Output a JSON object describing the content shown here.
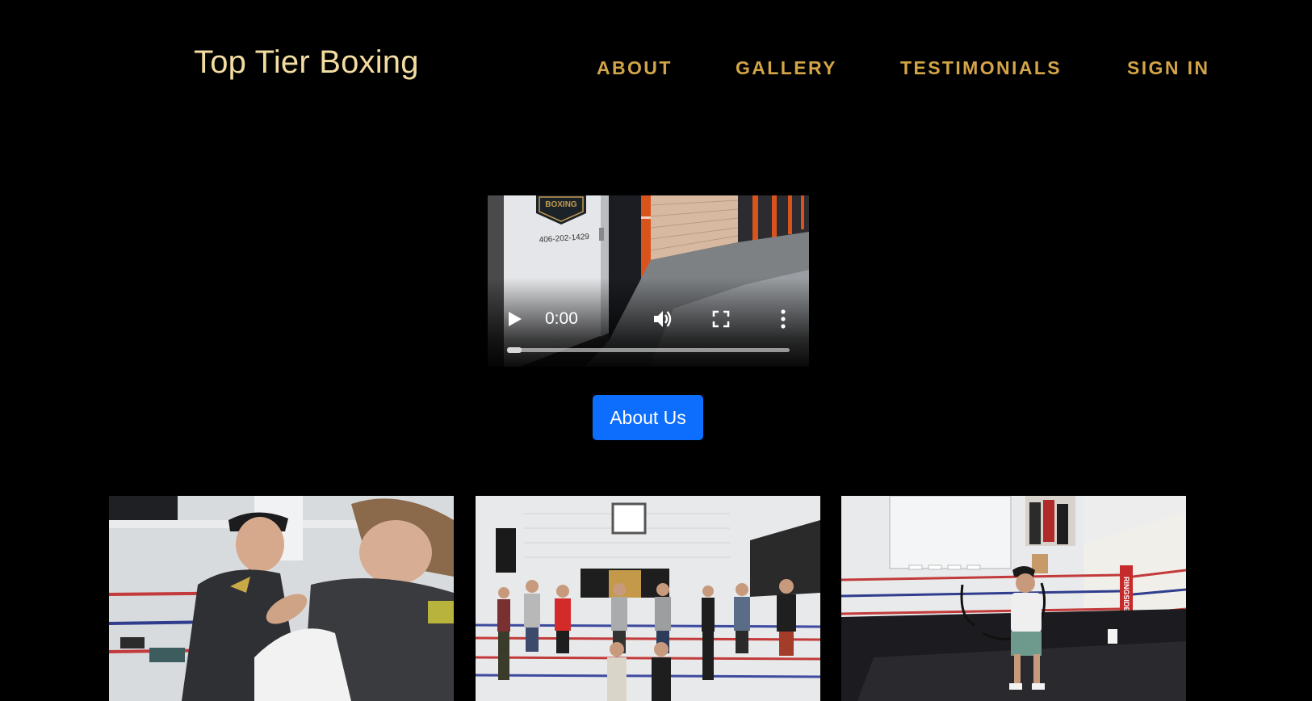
{
  "header": {
    "brand": "Top Tier Boxing",
    "nav": [
      {
        "label": "ABOUT"
      },
      {
        "label": "GALLERY"
      },
      {
        "label": "TESTIMONIALS"
      },
      {
        "label": "SIGN IN"
      }
    ]
  },
  "video": {
    "current_time": "0:00",
    "progress": 0,
    "sign_phone": "406-202-1429",
    "sign_text": "BOXING"
  },
  "about_button": {
    "label": "About Us"
  },
  "gallery": {
    "images": [
      {
        "alt": "Trainer wrapping a boxer's hands in the gym"
      },
      {
        "alt": "Group of boxers standing in the ring"
      },
      {
        "alt": "Boxer jumping rope inside the ring"
      }
    ],
    "ringside_text": "RINGSIDE"
  },
  "colors": {
    "background": "#000000",
    "brand": "#f3dca0",
    "nav": "#d4a548",
    "button": "#0d6efd"
  }
}
